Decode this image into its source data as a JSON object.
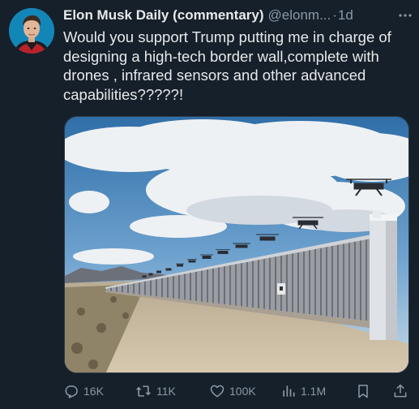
{
  "tweet": {
    "display_name": "Elon Musk Daily (commentary)",
    "handle": "@elonm...",
    "separator": "·",
    "time": "1d",
    "text": "Would you support Trump putting me in charge of designing a high-tech border wall,complete with drones , infrared sensors and other advanced capabilities?????!"
  },
  "actions": {
    "replies": "16K",
    "reposts": "11K",
    "likes": "100K",
    "views": "1.1M"
  },
  "icons": {
    "more": "more-horizontal-icon",
    "reply": "reply-icon",
    "repost": "repost-icon",
    "like": "heart-icon",
    "views": "views-icon",
    "bookmark": "bookmark-icon",
    "share": "share-icon"
  },
  "colors": {
    "background": "#16202b",
    "primary_text": "#e7e9ea",
    "secondary_text": "#8b98a5"
  }
}
